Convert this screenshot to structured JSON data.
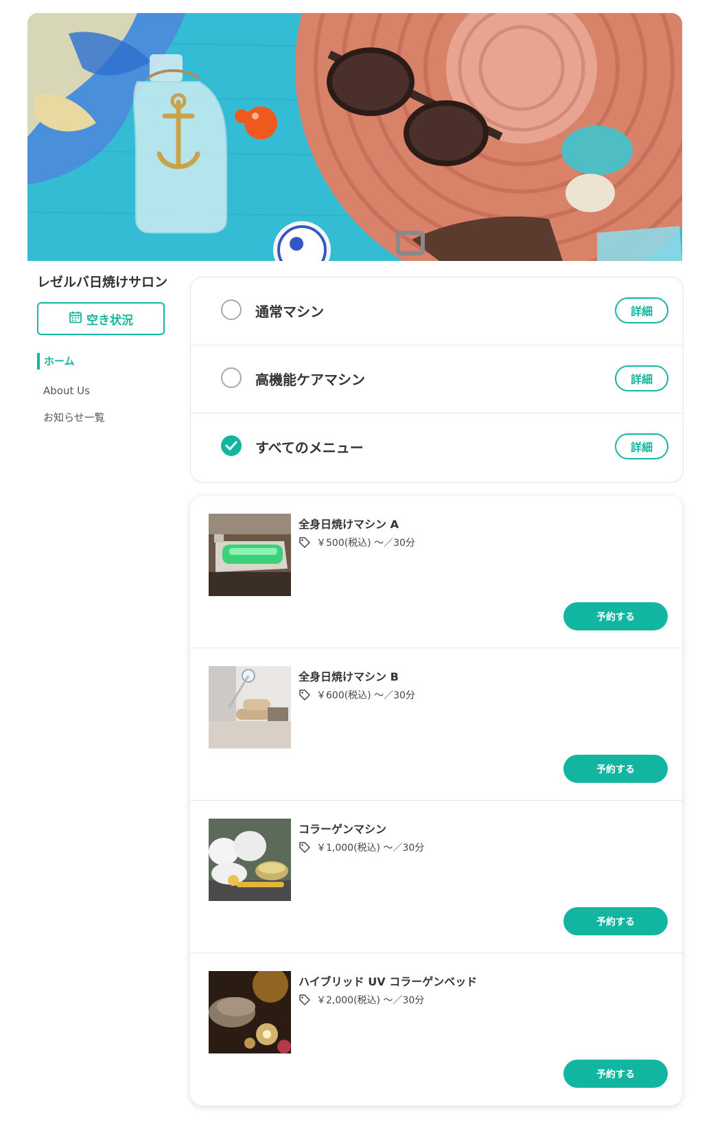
{
  "salon": {
    "name": "レゼルバ日焼けサロン"
  },
  "sidebar": {
    "availability_label": "空き状況",
    "nav": [
      {
        "label": "ホーム",
        "active": true
      },
      {
        "label": "About Us",
        "active": false
      },
      {
        "label": "お知らせ一覧",
        "active": false
      }
    ]
  },
  "categories": [
    {
      "label": "通常マシン",
      "selected": false,
      "detail_label": "詳細"
    },
    {
      "label": "高機能ケアマシン",
      "selected": false,
      "detail_label": "詳細"
    },
    {
      "label": "すべてのメニュー",
      "selected": true,
      "detail_label": "詳細"
    }
  ],
  "menu_items": [
    {
      "name": "全身日焼けマシン A",
      "price": "￥500(税込) 〜／30分",
      "reserve_label": "予約する"
    },
    {
      "name": "全身日焼けマシン B",
      "price": "￥600(税込) 〜／30分",
      "reserve_label": "予約する"
    },
    {
      "name": "コラーゲンマシン",
      "price": "￥1,000(税込) 〜／30分",
      "reserve_label": "予約する"
    },
    {
      "name": "ハイブリッド UV コラーゲンベッド",
      "price": "￥2,000(税込) 〜／30分",
      "reserve_label": "予約する"
    }
  ],
  "icons": {
    "availability": "calendar-icon",
    "price": "tag-icon",
    "selected": "check-icon"
  },
  "colors": {
    "accent": "#12b5a0",
    "text": "#333333",
    "border": "#e2e2e2"
  }
}
